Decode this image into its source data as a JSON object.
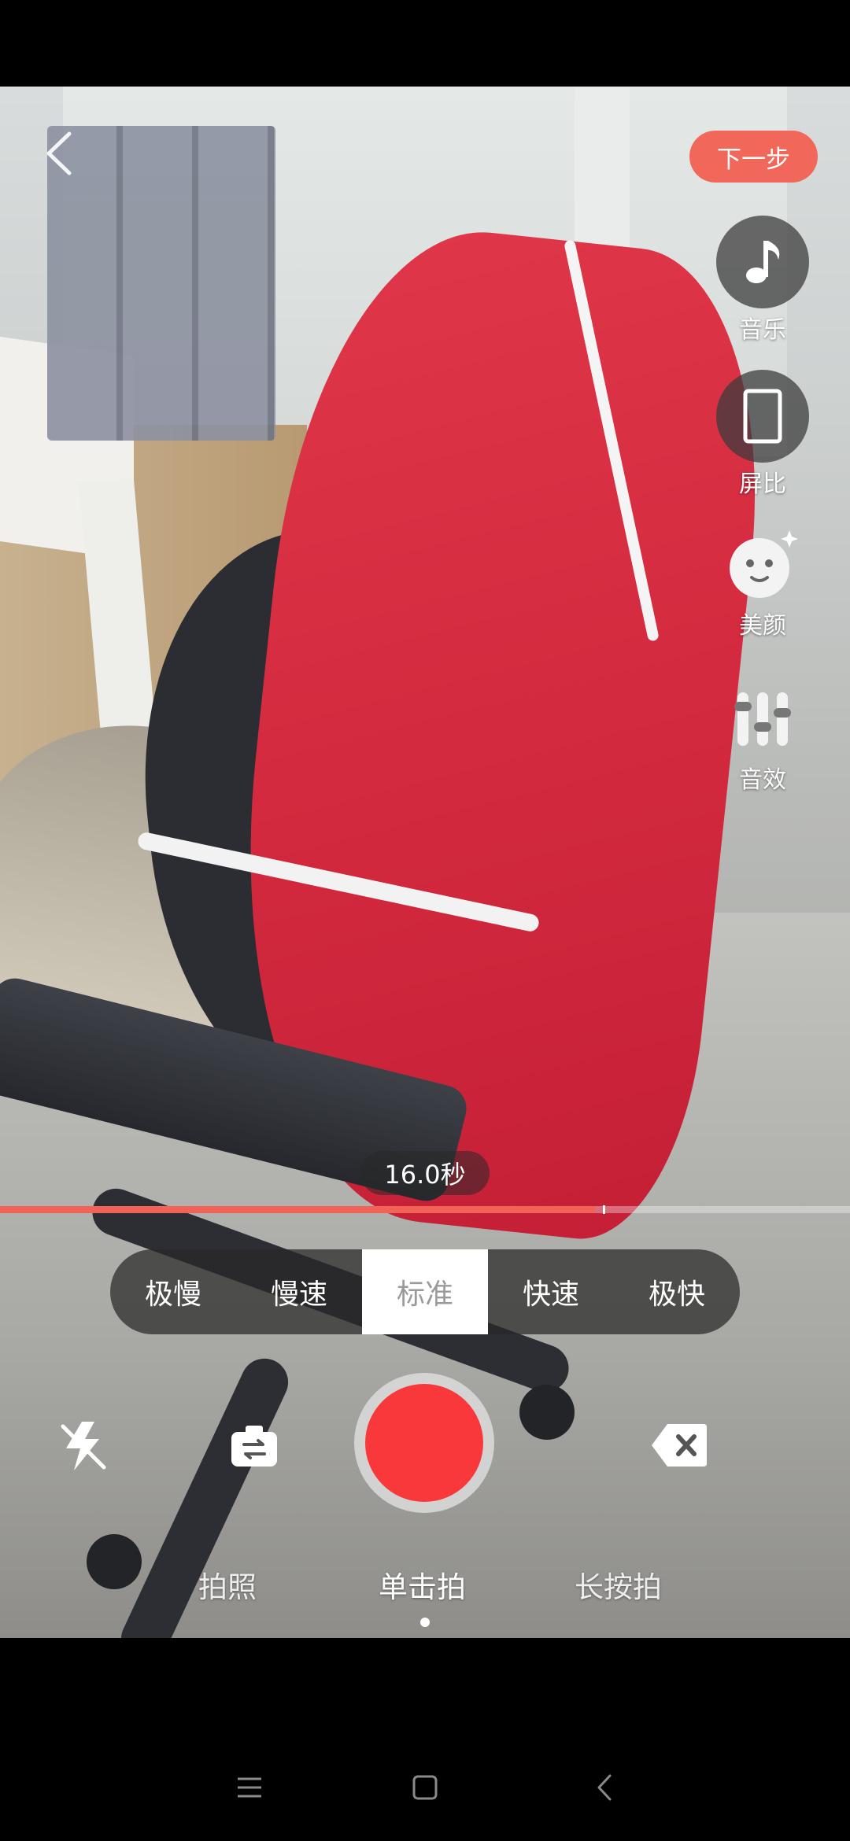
{
  "top_bar": {
    "next_label": "下一步"
  },
  "side_tools": [
    {
      "label": "音乐",
      "icon": "music-note-icon"
    },
    {
      "label": "屏比",
      "icon": "aspect-ratio-icon"
    },
    {
      "label": "美颜",
      "icon": "beauty-face-icon"
    },
    {
      "label": "音效",
      "icon": "sound-effect-icon"
    }
  ],
  "recording": {
    "timer": "16.0秒",
    "progress_fraction": 0.7
  },
  "speed": {
    "options": [
      "极慢",
      "慢速",
      "标准",
      "快速",
      "极快"
    ],
    "selected": "标准"
  },
  "modes": {
    "items": [
      "拍照",
      "单击拍",
      "长按拍"
    ],
    "selected": "单击拍"
  },
  "colors": {
    "accent": "#f06356",
    "record": "#f8383a"
  }
}
